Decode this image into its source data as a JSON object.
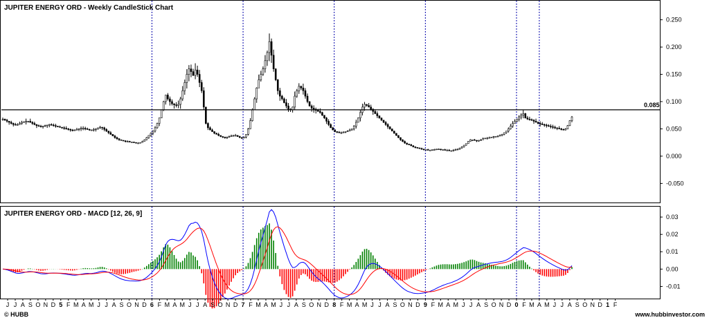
{
  "chart_data": [
    {
      "type": "candlestick",
      "title": "JUPITER ENERGY ORD - Weekly CandleStick Chart",
      "ylim": [
        -0.085,
        0.285
      ],
      "yticks": [
        0.25,
        0.2,
        0.15,
        0.1,
        0.05,
        0.0,
        -0.05
      ],
      "ytick_labels": [
        "0.250",
        "0.200",
        "0.150",
        "0.100",
        "0.050",
        "0.000",
        "-0.050"
      ],
      "horizontal_line": {
        "value": 0.085,
        "label": "0.085"
      },
      "series": [
        {
          "name": "close",
          "values": [
            0.068,
            0.066,
            0.064,
            0.062,
            0.06,
            0.058,
            0.057,
            0.058,
            0.06,
            0.062,
            0.063,
            0.064,
            0.064,
            0.062,
            0.06,
            0.058,
            0.056,
            0.055,
            0.054,
            0.055,
            0.056,
            0.057,
            0.058,
            0.057,
            0.056,
            0.055,
            0.054,
            0.053,
            0.052,
            0.051,
            0.05,
            0.049,
            0.048,
            0.047,
            0.048,
            0.049,
            0.05,
            0.051,
            0.051,
            0.05,
            0.049,
            0.048,
            0.048,
            0.049,
            0.05,
            0.052,
            0.053,
            0.052,
            0.049,
            0.046,
            0.043,
            0.04,
            0.037,
            0.034,
            0.032,
            0.03,
            0.029,
            0.028,
            0.027,
            0.027,
            0.026,
            0.026,
            0.025,
            0.024,
            0.024,
            0.025,
            0.027,
            0.03,
            0.034,
            0.038,
            0.042,
            0.046,
            0.052,
            0.06,
            0.07,
            0.085,
            0.1,
            0.112,
            0.105,
            0.1,
            0.096,
            0.094,
            0.093,
            0.095,
            0.105,
            0.12,
            0.135,
            0.15,
            0.16,
            0.155,
            0.148,
            0.158,
            0.15,
            0.135,
            0.12,
            0.09,
            0.06,
            0.052,
            0.048,
            0.045,
            0.042,
            0.04,
            0.038,
            0.036,
            0.035,
            0.034,
            0.035,
            0.036,
            0.037,
            0.038,
            0.038,
            0.036,
            0.034,
            0.033,
            0.035,
            0.04,
            0.05,
            0.065,
            0.085,
            0.105,
            0.125,
            0.14,
            0.15,
            0.16,
            0.175,
            0.19,
            0.21,
            0.185,
            0.16,
            0.14,
            0.12,
            0.11,
            0.105,
            0.098,
            0.092,
            0.086,
            0.085,
            0.09,
            0.11,
            0.12,
            0.128,
            0.125,
            0.12,
            0.11,
            0.1,
            0.092,
            0.088,
            0.086,
            0.084,
            0.082,
            0.08,
            0.075,
            0.07,
            0.064,
            0.058,
            0.052,
            0.048,
            0.045,
            0.044,
            0.043,
            0.043,
            0.044,
            0.045,
            0.046,
            0.048,
            0.05,
            0.055,
            0.062,
            0.07,
            0.08,
            0.09,
            0.095,
            0.093,
            0.09,
            0.086,
            0.082,
            0.078,
            0.074,
            0.07,
            0.066,
            0.062,
            0.058,
            0.054,
            0.05,
            0.046,
            0.042,
            0.038,
            0.034,
            0.03,
            0.027,
            0.024,
            0.022,
            0.021,
            0.019,
            0.017,
            0.016,
            0.015,
            0.014,
            0.013,
            0.012,
            0.012,
            0.011,
            0.011,
            0.012,
            0.012,
            0.013,
            0.013,
            0.012,
            0.012,
            0.011,
            0.011,
            0.01,
            0.01,
            0.011,
            0.012,
            0.013,
            0.015,
            0.017,
            0.02,
            0.023,
            0.027,
            0.03,
            0.03,
            0.029,
            0.028,
            0.029,
            0.03,
            0.032,
            0.033,
            0.033,
            0.034,
            0.035,
            0.036,
            0.036,
            0.037,
            0.038,
            0.04,
            0.043,
            0.046,
            0.05,
            0.055,
            0.06,
            0.064,
            0.068,
            0.072,
            0.075,
            0.078,
            0.07,
            0.068,
            0.067,
            0.066,
            0.064,
            0.062,
            0.06,
            0.059,
            0.058,
            0.057,
            0.056,
            0.055,
            0.054,
            0.053,
            0.052,
            0.051,
            0.05,
            0.049,
            0.048,
            0.05,
            0.056,
            0.065,
            0.072
          ]
        }
      ]
    },
    {
      "type": "macd",
      "title": "JUPITER ENERGY ORD - MACD [12, 26, 9]",
      "ylim": [
        -0.017,
        0.036
      ],
      "yticks": [
        0.03,
        0.02,
        0.01,
        0.0,
        -0.01
      ],
      "ytick_labels": [
        "0.03",
        "0.02",
        "0.01",
        "0.00",
        "-0.01"
      ],
      "series": [
        {
          "name": "MACD",
          "color": "#0000ff"
        },
        {
          "name": "Signal",
          "color": "#ff0000"
        },
        {
          "name": "Histogram",
          "color_positive": "#008000",
          "color_negative": "#ff0000"
        }
      ]
    }
  ],
  "x_axis": {
    "labels": [
      "J",
      "J",
      "A",
      "S",
      "O",
      "N",
      "D",
      "5",
      "F",
      "M",
      "A",
      "M",
      "J",
      "J",
      "A",
      "S",
      "O",
      "N",
      "D",
      "6",
      "F",
      "M",
      "A",
      "M",
      "J",
      "J",
      "A",
      "S",
      "O",
      "N",
      "D",
      "7",
      "F",
      "M",
      "A",
      "M",
      "J",
      "J",
      "A",
      "S",
      "O",
      "N",
      "D",
      "8",
      "F",
      "M",
      "A",
      "M",
      "J",
      "J",
      "A",
      "S",
      "O",
      "N",
      "D",
      "9",
      "F",
      "M",
      "A",
      "M",
      "J",
      "J",
      "A",
      "S",
      "O",
      "N",
      "D",
      "0",
      "F",
      "M",
      "A",
      "M",
      "J",
      "J",
      "A",
      "S",
      "O",
      "N",
      "D",
      "1",
      "F"
    ],
    "year_marker_labels": [
      "5",
      "6",
      "7",
      "8",
      "9",
      "0",
      "1"
    ],
    "period_separator_year_labels": [
      "6",
      "7",
      "8",
      "9",
      "0"
    ],
    "data_end_label": "A"
  },
  "footer": {
    "left": "© HUBB",
    "right": "www.hubbinvestor.com"
  },
  "colors": {
    "background": "#ffffff",
    "candle": "#000000",
    "separator": "#0000aa",
    "macd": "#0000ff",
    "signal": "#ff0000",
    "hist_positive": "#008000",
    "hist_negative": "#ff0000"
  }
}
